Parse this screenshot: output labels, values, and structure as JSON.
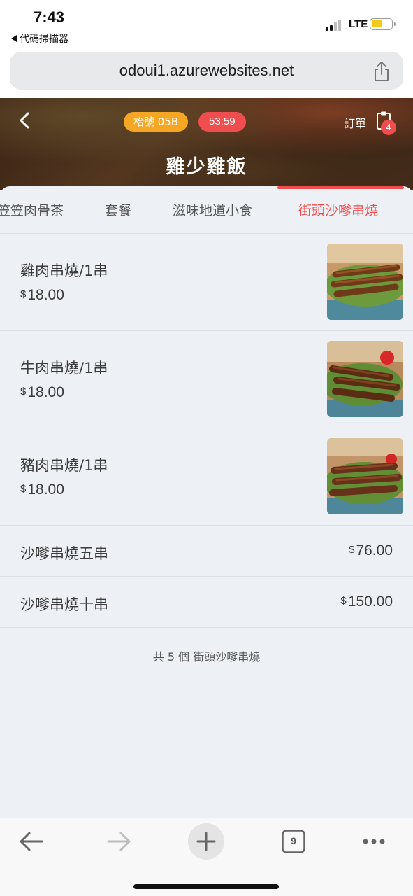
{
  "status_bar": {
    "time": "7:43",
    "back_app": "代碼掃描器",
    "network": "LTE"
  },
  "browser": {
    "url": "odoui1.azurewebsites.net",
    "tab_count": "9"
  },
  "header": {
    "table_label": "枱號 05B",
    "timer": "53:59",
    "order_label": "訂單",
    "order_count": "4",
    "shop_name": "雞少雞飯"
  },
  "tabs": [
    {
      "label": "笠笠肉骨茶",
      "active": false
    },
    {
      "label": "套餐",
      "active": false
    },
    {
      "label": "滋味地道小食",
      "active": false
    },
    {
      "label": "街頭沙嗲串燒",
      "active": true
    }
  ],
  "items": [
    {
      "name": "雞肉串燒/1串",
      "currency": "$",
      "price": "18.00",
      "image": "chicken-skewer-photo"
    },
    {
      "name": "牛肉串燒/1串",
      "currency": "$",
      "price": "18.00",
      "image": "beef-skewer-photo"
    },
    {
      "name": "豬肉串燒/1串",
      "currency": "$",
      "price": "18.00",
      "image": "pork-skewer-photo"
    },
    {
      "name": "沙嗲串燒五串",
      "currency": "$",
      "price": "76.00"
    },
    {
      "name": "沙嗲串燒十串",
      "currency": "$",
      "price": "150.00"
    }
  ],
  "summary": "共 5 個 街頭沙嗲串燒",
  "colors": {
    "accent": "#f04e4e",
    "table_pill": "#f5a623",
    "background": "#edf0f4"
  }
}
